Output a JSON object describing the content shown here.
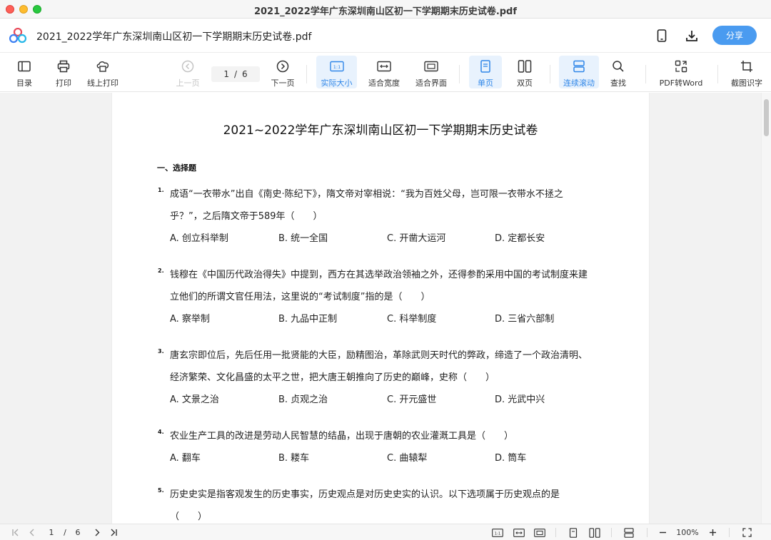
{
  "window": {
    "title": "2021_2022学年广东深圳南山区初一下学期期末历史试卷.pdf"
  },
  "header": {
    "doc_name": "2021_2022学年广东深圳南山区初一下学期期末历史试卷.pdf",
    "share_label": "分享"
  },
  "toolbar": {
    "toc": "目录",
    "print": "打印",
    "online_print": "线上打印",
    "prev_page": "上一页",
    "current_page": "1",
    "page_separator": "/",
    "total_pages": "6",
    "next_page": "下一页",
    "actual_size": "实际大小",
    "fit_width": "适合宽度",
    "fit_page": "适合界面",
    "single_page": "单页",
    "double_page": "双页",
    "continuous_scroll": "连续滚动",
    "find": "查找",
    "pdf_to_word": "PDF转Word",
    "screenshot_ocr": "截图识字"
  },
  "document": {
    "title": "2021~2022学年广东深圳南山区初一下学期期末历史试卷",
    "section": "一、选择题",
    "questions": [
      {
        "num": "1.",
        "lines": [
          "成语“一衣带水”出自《南史·陈纪下》，隋文帝对宰相说：“我为百姓父母，岂可限一衣带水不拯之",
          "乎？”，之后隋文帝于589年（　　）"
        ],
        "options": [
          "A. 创立科举制",
          "B. 统一全国",
          "C. 开凿大运河",
          "D. 定都长安"
        ]
      },
      {
        "num": "2.",
        "lines": [
          "钱穆在《中国历代政治得失》中提到，西方在其选举政治领袖之外，还得参酌采用中国的考试制度来建",
          "立他们的所谓文官任用法，这里说的“考试制度”指的是（　　）"
        ],
        "options": [
          "A. 察举制",
          "B. 九品中正制",
          "C. 科举制度",
          "D. 三省六部制"
        ]
      },
      {
        "num": "3.",
        "lines": [
          "唐玄宗即位后，先后任用一批贤能的大臣，励精图治，革除武则天时代的弊政，缔造了一个政治清明、",
          "经济繁荣、文化昌盛的太平之世，把大唐王朝推向了历史的巅峰，史称（　　）"
        ],
        "options": [
          "A. 文景之治",
          "B. 贞观之治",
          "C. 开元盛世",
          "D. 光武中兴"
        ]
      },
      {
        "num": "4.",
        "lines": [
          "农业生产工具的改进是劳动人民智慧的结晶，出现于唐朝的农业灌溉工具是（　　）"
        ],
        "options": [
          "A. 翻车",
          "B. 耧车",
          "C. 曲辕犁",
          "D. 筒车"
        ]
      },
      {
        "num": "5.",
        "lines": [
          "历史史实是指客观发生的历史事实，历史观点是对历史史实的认识。以下选项属于历史观点的是",
          "（　　）"
        ],
        "options": []
      }
    ]
  },
  "statusbar": {
    "current_page": "1",
    "separator": "/",
    "total_pages": "6",
    "zoom": "100%"
  },
  "colors": {
    "accent": "#4a9bf0",
    "active_bg": "#e8f2fd",
    "active_text": "#2f86e8",
    "workspace_bg": "#f2f2f2"
  }
}
